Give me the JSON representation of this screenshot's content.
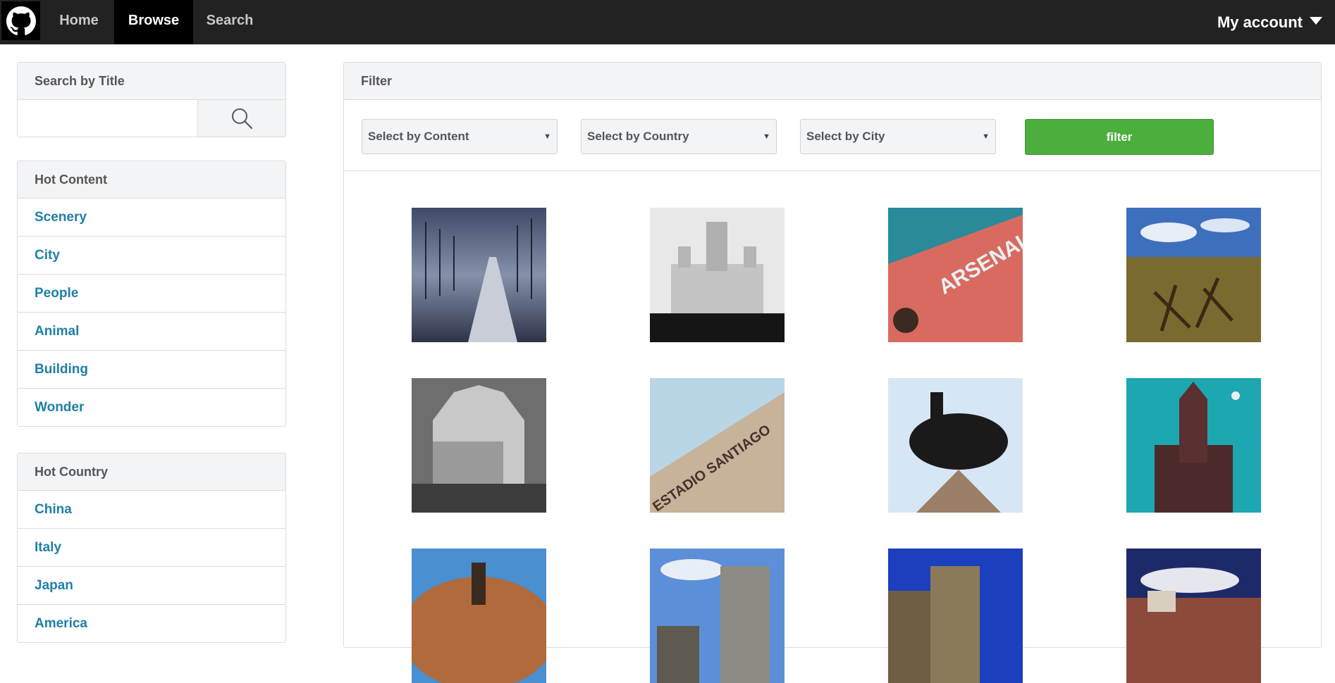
{
  "nav": {
    "home": "Home",
    "browse": "Browse",
    "search": "Search",
    "account": "My account"
  },
  "sidebar": {
    "search_title": "Search by Title",
    "search_value": "",
    "hot_content": {
      "title": "Hot Content",
      "items": [
        "Scenery",
        "City",
        "People",
        "Animal",
        "Building",
        "Wonder"
      ]
    },
    "hot_country": {
      "title": "Hot Country",
      "items": [
        "China",
        "Italy",
        "Japan",
        "America"
      ]
    }
  },
  "main": {
    "title": "Filter",
    "select_content": "Select by Content",
    "select_country": "Select by Country",
    "select_city": "Select by City",
    "filter_button": "filter"
  },
  "colors": {
    "nav_bg": "#222222",
    "link": "#1f7fa8",
    "filter_button": "#4cae3c"
  },
  "gallery": {
    "rows_visible": 3,
    "columns": 4
  }
}
